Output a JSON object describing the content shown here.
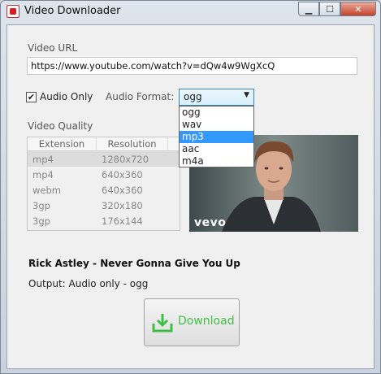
{
  "window": {
    "title": "Video Downloader"
  },
  "caption": {
    "minimize": "▁",
    "maximize": "☐",
    "close": "✕"
  },
  "form": {
    "url_label": "Video URL",
    "url_value": "https://www.youtube.com/watch?v=dQw4w9WgXcQ",
    "audio_only_label": "Audio Only",
    "audio_only_checked": true,
    "audio_format_label": "Audio Format:",
    "audio_format_selected": "ogg",
    "audio_format_options": [
      "ogg",
      "wav",
      "mp3",
      "aac",
      "m4a"
    ],
    "audio_format_highlighted": "mp3",
    "quality_label": "Video Quality"
  },
  "quality_table": {
    "headers": [
      "Extension",
      "Resolution"
    ],
    "rows": [
      [
        "mp4",
        "1280x720"
      ],
      [
        "mp4",
        "640x360"
      ],
      [
        "webm",
        "640x360"
      ],
      [
        "3gp",
        "320x180"
      ],
      [
        "3gp",
        "176x144"
      ]
    ],
    "selected_row": 0
  },
  "video": {
    "title": "Rick Astley - Never Gonna Give You Up",
    "thumbnail_watermark": "vevo"
  },
  "output_text": "Output: Audio only - ogg",
  "download_label": "Download",
  "colors": {
    "accent_green": "#3fbf45",
    "selection_blue": "#3399ff"
  }
}
